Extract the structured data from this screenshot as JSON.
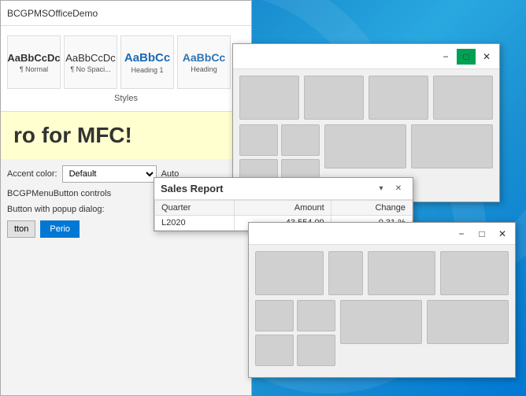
{
  "wallpaper": {
    "alt": "Windows 11 wallpaper"
  },
  "main_window": {
    "title": "BCGPMSOfficeDemo",
    "styles_label": "Styles",
    "style_items": [
      {
        "label": "¶ Normal",
        "style": "normal",
        "preview": "AaBbCcDc"
      },
      {
        "label": "¶ No Spaci...",
        "style": "normal",
        "preview": "AaBbCcDc"
      },
      {
        "label": "",
        "style": "heading1",
        "preview": "AaBbCc"
      },
      {
        "label": "",
        "style": "heading",
        "preview": "AaBbCc"
      }
    ],
    "heading_label": "Heading",
    "mfc_text": "ro for MFC!",
    "accent_label": "Accent color:",
    "accent_value": "Default",
    "auto_label": "Auto",
    "controls_label": "BCGPMenuButton controls",
    "button_popup_label": "Button with popup dialog:",
    "period_btn_label": "Perio",
    "small_btn_label": "tton"
  },
  "grid_panel_1": {
    "min_label": "−",
    "max_label": "□",
    "close_label": "✕",
    "cells": [
      {
        "row": 0,
        "cells": 3
      },
      {
        "row": 1,
        "cells": 3
      }
    ]
  },
  "sales_window": {
    "title": "Sales Report",
    "min_label": "▾",
    "close_label": "✕",
    "columns": [
      "Quarter",
      "Amount",
      "Change"
    ],
    "rows": [
      {
        "quarter": "L2020",
        "amount": "43 554.09",
        "change": "0.31 %"
      }
    ]
  },
  "grid_panel_2": {
    "min_label": "−",
    "max_label": "□",
    "close_label": "✕"
  }
}
